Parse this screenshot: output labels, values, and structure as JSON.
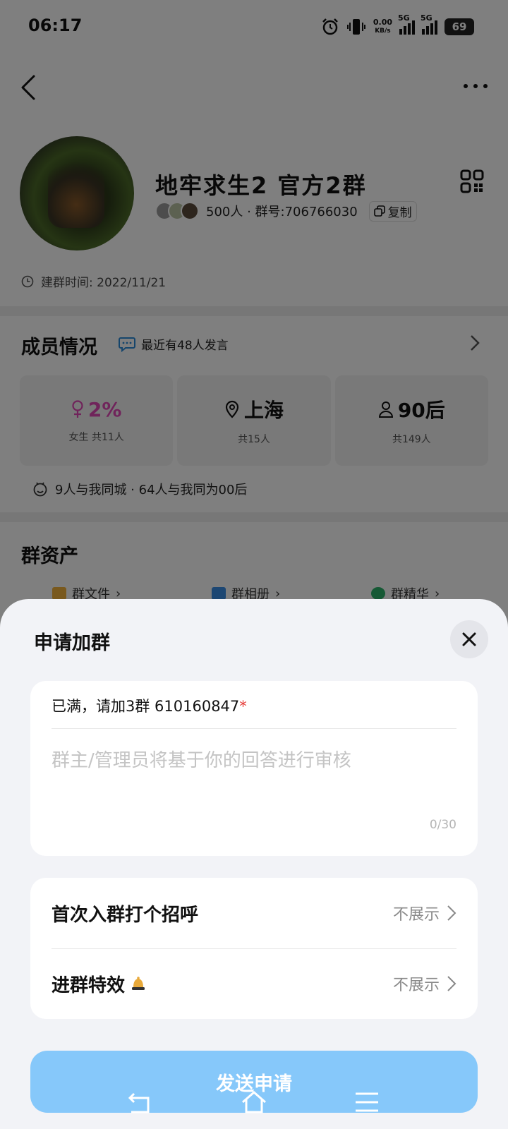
{
  "status": {
    "time": "06:17",
    "net_speed": "0.00",
    "net_unit": "KB/s",
    "sim1": "5G",
    "sim2": "5G",
    "battery": "69"
  },
  "group": {
    "name": "地牢求生2 官方2群",
    "members_text": "500人 · 群号:706766030",
    "copy_label": "复制",
    "created": "建群时间: 2022/11/21"
  },
  "members": {
    "title": "成员情况",
    "recent": "最近有48人发言",
    "stats": [
      {
        "value": "2%",
        "sub": "女生 共11人",
        "icon": "female-icon"
      },
      {
        "value": "上海",
        "sub": "共15人",
        "icon": "location-pin-icon"
      },
      {
        "value": "90后",
        "sub": "共149人",
        "icon": "person-icon"
      }
    ],
    "same_city": "9人与我同城 · 64人与我同为00后"
  },
  "assets": {
    "title": "群资产",
    "items": [
      "群文件",
      "群相册",
      "群精华"
    ]
  },
  "sheet": {
    "title": "申请加群",
    "question": "已满，请加3群 610160847",
    "required_mark": "*",
    "answer_placeholder": "群主/管理员将基于你的回答进行审核",
    "counter": "0/30",
    "rows": [
      {
        "label": "首次入群打个招呼",
        "value": "不展示"
      },
      {
        "label": "进群特效",
        "value": "不展示"
      }
    ],
    "send_label": "发送申请"
  },
  "colors": {
    "accent_pink": "#e048b6",
    "send_button": "#86c8fa",
    "required": "#e53935"
  }
}
